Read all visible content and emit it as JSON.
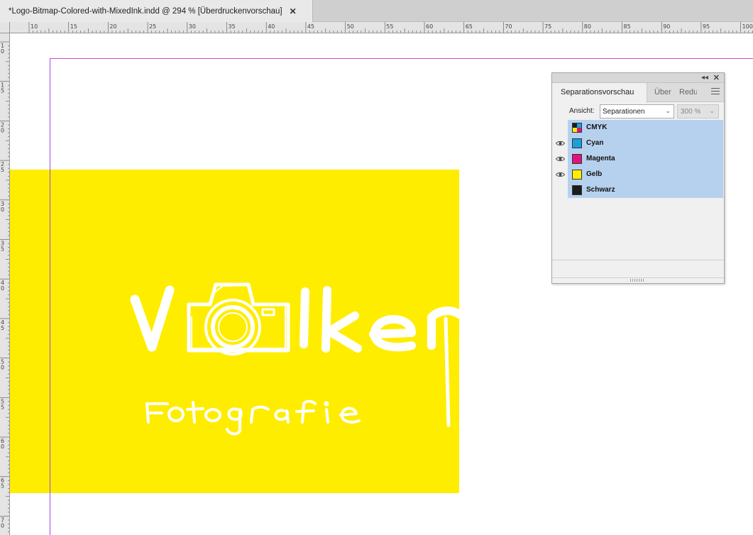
{
  "document_tab": {
    "title": "*Logo-Bitmap-Colored-with-MixedInk.indd @ 294 % [Überdruckenvorschau]",
    "close_glyph": "✕"
  },
  "ruler": {
    "horizontal_labels": [
      "10",
      "15",
      "20",
      "25",
      "30",
      "35",
      "40",
      "45",
      "50",
      "55",
      "60",
      "65",
      "70",
      "75",
      "80",
      "85",
      "90",
      "95",
      "100"
    ],
    "vertical_labels": [
      "10",
      "15",
      "20",
      "25",
      "30",
      "35",
      "40",
      "45",
      "50",
      "55",
      "60",
      "65",
      "70"
    ]
  },
  "colors": {
    "yellow": "#ffed00",
    "logo": "#ffffff",
    "selection": "#b6d1ee",
    "margin_guide": "#d44ad4"
  },
  "panel": {
    "tabs": [
      "Separationsvorschau",
      "Über",
      "Redu"
    ],
    "collapse_glyph": "◂◂",
    "close_glyph": "✕",
    "view_label": "Ansicht:",
    "view_value": "Separationen",
    "zoom_value": "300 %",
    "separations": [
      {
        "name": "CMYK",
        "color": "cmyk",
        "visible": false
      },
      {
        "name": "Cyan",
        "color": "#1aa0dd",
        "visible": true
      },
      {
        "name": "Magenta",
        "color": "#e0137e",
        "visible": true
      },
      {
        "name": "Gelb",
        "color": "#ffed00",
        "visible": true
      },
      {
        "name": "Schwarz",
        "color": "#1c1c1c",
        "visible": false
      }
    ]
  }
}
